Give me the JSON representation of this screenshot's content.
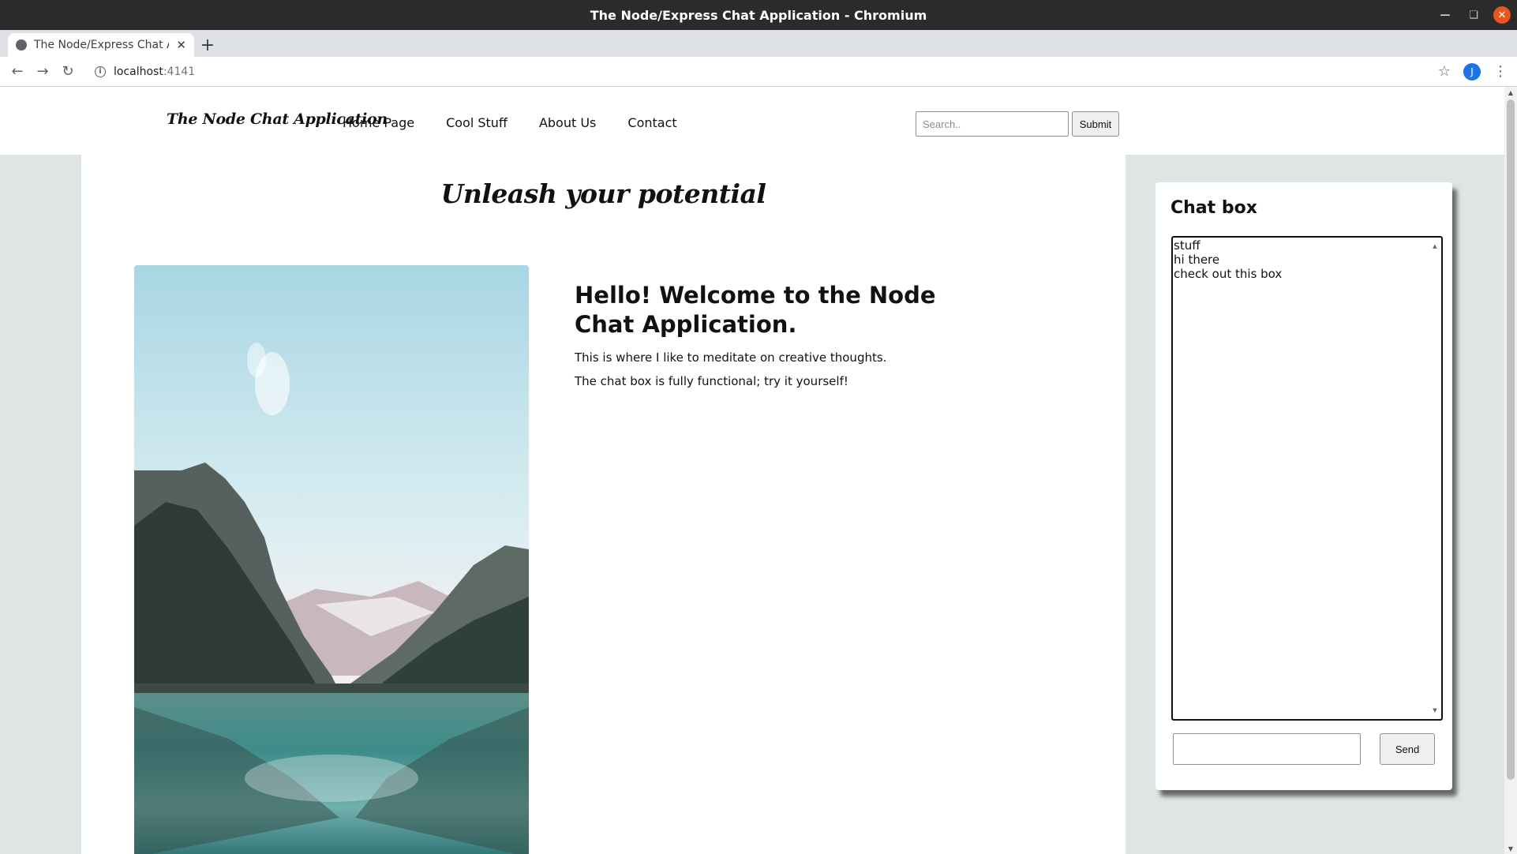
{
  "window": {
    "title": "The Node/Express Chat Application - Chromium"
  },
  "browser": {
    "tab_title": "The Node/Express Chat Application",
    "url_host": "localhost",
    "url_port": ":4141",
    "profile_initial": "J"
  },
  "site": {
    "logo": "The Node Chat Application",
    "nav": [
      "Home Page",
      "Cool Stuff",
      "About Us",
      "Contact"
    ],
    "search_placeholder": "Search..",
    "submit_label": "Submit",
    "tagline": "Unleash your potential",
    "welcome_heading": "Hello! Welcome to the Node Chat Application.",
    "welcome_paragraphs": [
      "This is where I like to meditate on creative thoughts.",
      "The chat box is fully functional; try it yourself!"
    ]
  },
  "chat": {
    "title": "Chat box",
    "messages": [
      "stuff",
      "hi there",
      "check out this box"
    ],
    "input_value": "",
    "send_label": "Send"
  },
  "colors": {
    "page_background": "#dfe5e5",
    "titlebar": "#2b2b2b",
    "tabstrip": "#dee1e6",
    "close_button": "#e95420",
    "profile_avatar": "#1a73e8"
  }
}
